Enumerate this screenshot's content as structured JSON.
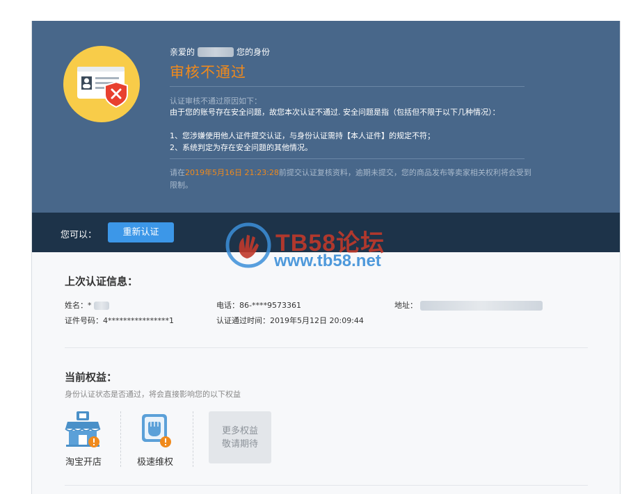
{
  "header": {
    "greeting_prefix": "亲爱的",
    "greeting_suffix": "您的身份",
    "status_title": "审核不通过",
    "reason_heading": "认证审核不通过原因如下：",
    "reason_main": "由于您的账号存在安全问题，故您本次认证不通过. 安全问题是指（包括但不限于以下几种情况）：",
    "reasons": [
      "1、您涉嫌使用他人证件提交认证，与身份认证需持【本人证件】的规定不符；",
      "2、系统判定为存在安全问题的其他情况。"
    ],
    "deadline_prefix": "请在",
    "deadline_datetime": "2019年5月16日 21:23:28",
    "deadline_suffix": "前提交认证复核资料，逾期未提交，您的商品发布等卖家相关权利将会受到限制。",
    "status_color": "#f08a1c"
  },
  "actionbar": {
    "label": "您可以：",
    "reverify_button": "重新认证"
  },
  "watermark": {
    "title": "TB58论坛",
    "url": "www.tb58.net"
  },
  "last_info": {
    "title": "上次认证信息：",
    "name_label": "姓名：",
    "name_value": "*",
    "id_label": "证件号码：",
    "id_value": "4****************1",
    "phone_label": "电话：",
    "phone_value": "86-****9573361",
    "verified_time_label": "认证通过时间：",
    "verified_time_value": "2019年5月12日 20:09:44",
    "address_label": "地址："
  },
  "rights": {
    "title": "当前权益：",
    "description": "身份认证状态是否通过，将会直接影响您的以下权益",
    "items": [
      {
        "label": "淘宝开店",
        "icon": "shop-icon"
      },
      {
        "label": "极速维权",
        "icon": "fist-icon"
      }
    ],
    "more_line1": "更多权益",
    "more_line2": "敬请期待"
  }
}
